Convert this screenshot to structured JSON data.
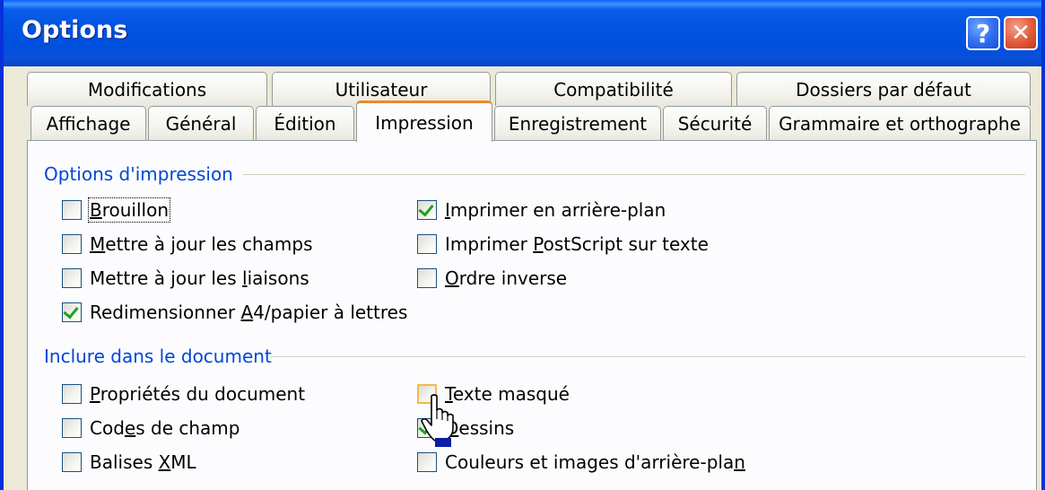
{
  "window": {
    "title": "Options",
    "help_label": "?",
    "close_label": "✕",
    "title_bar_color": "#0054e3"
  },
  "tabs": {
    "back_row": [
      {
        "label": "Modifications"
      },
      {
        "label": "Utilisateur"
      },
      {
        "label": "Compatibilité"
      },
      {
        "label": "Dossiers par défaut"
      }
    ],
    "front_row": [
      {
        "label": "Affichage"
      },
      {
        "label": "Général"
      },
      {
        "label": "Édition"
      },
      {
        "label": "Impression",
        "active": true
      },
      {
        "label": "Enregistrement"
      },
      {
        "label": "Sécurité"
      },
      {
        "label": "Grammaire et orthographe"
      }
    ]
  },
  "print_options": {
    "title": "Options d'impression",
    "items": [
      {
        "pre": "",
        "key": "B",
        "post": "rouillon",
        "checked": false
      },
      {
        "pre": "",
        "key": "M",
        "post": "ettre à jour les champs",
        "checked": false
      },
      {
        "pre": "Mettre à jour les ",
        "key": "l",
        "post": "iaisons",
        "checked": false
      },
      {
        "pre": "Redimensionner ",
        "key": "A",
        "post": "4/papier à lettres",
        "checked": true
      },
      {
        "pre": "",
        "key": "I",
        "post": "mprimer en arrière-plan",
        "checked": true
      },
      {
        "pre": "Imprimer ",
        "key": "P",
        "post": "ostScript sur texte",
        "checked": false
      },
      {
        "pre": "",
        "key": "O",
        "post": "rdre inverse",
        "checked": false
      }
    ]
  },
  "include_options": {
    "title": "Inclure dans le document",
    "items": [
      {
        "pre": "",
        "key": "P",
        "post": "ropriétés du document",
        "checked": false
      },
      {
        "pre": "Cod",
        "key": "e",
        "post": "s de champ",
        "checked": false
      },
      {
        "pre": "Balises ",
        "key": "X",
        "post": "ML",
        "checked": false
      },
      {
        "pre": "",
        "key": "T",
        "post": "exte masqué",
        "checked": false
      },
      {
        "pre": "",
        "key": "D",
        "post": "essins",
        "checked": true
      },
      {
        "pre": "Couleurs et images d'arrière-pla",
        "key": "n",
        "post": "",
        "checked": false
      }
    ]
  },
  "colors": {
    "accent_tab": "#e68b2c",
    "group_title": "#0046d5",
    "check_green": "#21a121"
  }
}
